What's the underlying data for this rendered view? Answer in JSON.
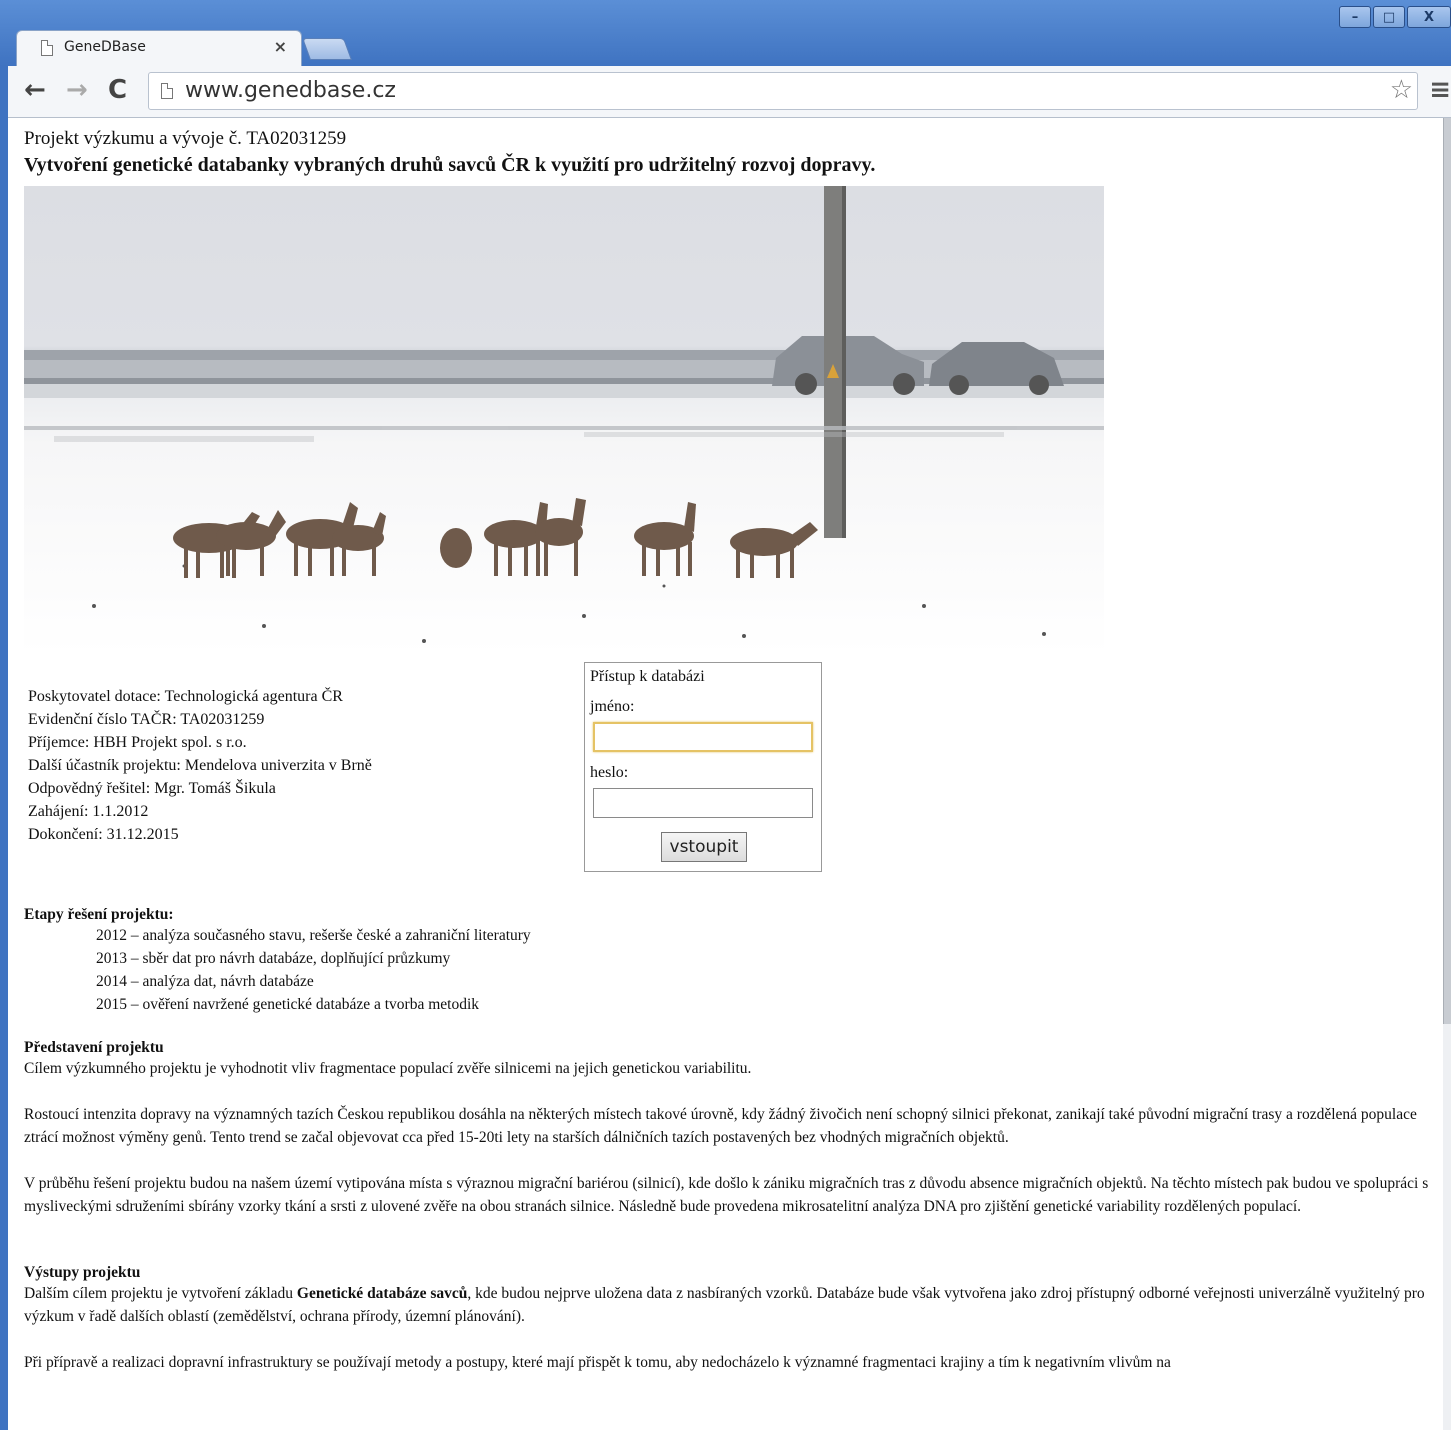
{
  "browser": {
    "tab_title": "GeneDBase",
    "tab_close": "×",
    "url": "www.genedbase.cz",
    "window_controls": {
      "minimize": "–",
      "maximize": "□",
      "close": "X"
    },
    "icons": {
      "back": "back-arrow-icon",
      "forward": "forward-arrow-icon",
      "reload": "reload-icon",
      "bookmark": "star-icon",
      "menu": "menu-icon"
    }
  },
  "page": {
    "project_number": "Projekt výzkumu a vývoje č. TA02031259",
    "project_title": "Vytvoření genetické databanky vybraných druhů savců ČR k využití pro udržitelný rozvoj dopravy.",
    "info_lines": [
      "Poskytovatel dotace: Technologická agentura ČR",
      "Evidenční číslo TAČR: TA02031259",
      "Příjemce: HBH Projekt spol. s r.o.",
      "Další účastník projektu: Mendelova univerzita v Brně",
      "Odpovědný řešitel: Mgr. Tomáš Šikula",
      "Zahájení: 1.1.2012",
      "Dokončení: 31.12.2015"
    ],
    "login": {
      "title": "Přístup k databázi",
      "username_label": "jméno:",
      "username_value": "",
      "password_label": "heslo:",
      "password_value": "",
      "submit_label": "vstoupit"
    },
    "stages": {
      "heading": "Etapy řešení projektu:",
      "items": [
        "2012 – analýza současného stavu, rešerše české a zahraniční literatury",
        "2013 – sběr dat pro návrh databáze, doplňující průzkumy",
        "2014 – analýza dat, návrh databáze",
        "2015 – ověření navržené genetické databáze a tvorba metodik"
      ]
    },
    "intro": {
      "heading": "Představení projektu",
      "p1": "Cílem výzkumného projektu je vyhodnotit vliv fragmentace populací zvěře silnicemi na jejich genetickou variabilitu.",
      "p2": "Rostoucí intenzita dopravy na významných tazích Českou republikou dosáhla na některých místech takové úrovně, kdy žádný živočich není schopný silnici překonat, zanikají také původní migrační trasy a rozdělená populace ztrácí možnost výměny genů. Tento trend se začal objevovat cca před 15-20ti lety na starších dálničních tazích postavených bez vhodných migračních objektů.",
      "p3": "V průběhu řešení projektu budou na našem území vytipována místa s výraznou migrační bariérou (silnicí), kde došlo k zániku migračních tras z důvodu absence migračních objektů. Na těchto místech pak budou ve spolupráci s mysliveckými sdruženími sbírány vzorky tkání a srsti z ulovené zvěře na obou stranách silnice. Následně bude provedena mikrosatelitní analýza DNA pro zjištění genetické variability rozdělených populací."
    },
    "outputs": {
      "heading": "Výstupy projektu",
      "p1_before": "Dalším cílem projektu je vytvoření základu ",
      "p1_bold": "Genetické databáze savců",
      "p1_after": ", kde budou nejprve uložena data z nasbíraných vzorků. Databáze bude však vytvořena jako zdroj přístupný odborné veřejnosti univerzálně využitelný pro výzkum v řadě dalších oblastí (zemědělství, ochrana přírody, územní plánování).",
      "p2": "Při přípravě a realizaci dopravní infrastruktury se používají metody a postupy, které mají přispět k tomu, aby nedocházelo k významné fragmentaci krajiny a tím k negativním vlivům na"
    }
  }
}
